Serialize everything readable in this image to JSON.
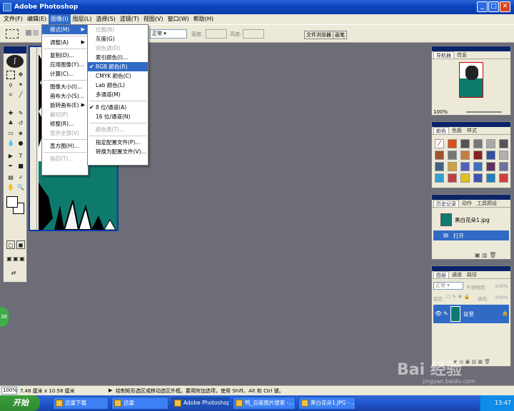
{
  "window": {
    "title": "Adobe Photoshop"
  },
  "menubar": [
    "文件(F)",
    "编辑(E)",
    "图像(I)",
    "图层(L)",
    "选择(S)",
    "滤镜(T)",
    "视图(V)",
    "窗口(W)",
    "帮助(H)"
  ],
  "options": {
    "mode_value": "正常",
    "width_label": "宽度:",
    "height_label": "高度:",
    "file_browser_tab": "文件浏览器",
    "brushes_tab": "画笔"
  },
  "image_menu": [
    {
      "label": "模式(M)",
      "arrow": true,
      "hl": true
    },
    {
      "sep": true
    },
    {
      "label": "调整(A)",
      "arrow": true
    },
    {
      "sep": true
    },
    {
      "label": "复制(D)..."
    },
    {
      "label": "应用图像(Y)..."
    },
    {
      "label": "计算(C)..."
    },
    {
      "sep": true
    },
    {
      "label": "图像大小(I)..."
    },
    {
      "label": "画布大小(S)..."
    },
    {
      "label": "旋转画布(E)",
      "arrow": true
    },
    {
      "label": "裁切(P)",
      "dis": true
    },
    {
      "label": "修整(R)..."
    },
    {
      "label": "显示全部(V)",
      "dis": true
    },
    {
      "sep": true
    },
    {
      "label": "直方图(H)..."
    },
    {
      "sep": true
    },
    {
      "label": "陷印(T)...",
      "dis": true
    }
  ],
  "mode_menu": [
    {
      "label": "位图(B)",
      "dis": true
    },
    {
      "label": "灰度(G)"
    },
    {
      "label": "双色调(D)",
      "dis": true
    },
    {
      "label": "索引颜色(I)..."
    },
    {
      "label": "RGB 颜色(R)",
      "checked": true,
      "hl": true
    },
    {
      "label": "CMYK 颜色(C)"
    },
    {
      "label": "Lab 颜色(L)"
    },
    {
      "label": "多通道(M)"
    },
    {
      "sep": true
    },
    {
      "label": "8 位/通道(A)",
      "checked": true
    },
    {
      "label": "16 位/通道(N)"
    },
    {
      "sep": true
    },
    {
      "label": "颜色表(T)...",
      "dis": true
    },
    {
      "sep": true
    },
    {
      "label": "指定配置文件(P)..."
    },
    {
      "label": "转换为配置文件(V)..."
    }
  ],
  "navigator": {
    "tabs": [
      "导航器",
      "信息"
    ],
    "zoom": "100%"
  },
  "swatches": {
    "tabs": [
      "颜色",
      "色板",
      "样式"
    ]
  },
  "history": {
    "tabs": [
      "历史记录",
      "动作",
      "工具预设"
    ],
    "snapshot": "黑白花朵1.jpg",
    "step": "打开"
  },
  "layers": {
    "tabs": [
      "图层",
      "通道",
      "路径"
    ],
    "blend": "正常",
    "opacity_label": "不透明度:",
    "opacity_value": "100%",
    "lock_label": "锁定:",
    "fill_label": "填充:",
    "fill_value": "100%",
    "layer_name": "背景"
  },
  "status": {
    "zoom": "100%",
    "doc_size": "7.48 厘米 x 10.58 厘米",
    "hint": "绘制矩形选区或移动选区外框。要用附加选项，使用 Shift、Alt 和 Ctrl 键。"
  },
  "taskbar": {
    "start": "开始",
    "tasks": [
      "迅雷下载",
      "迅雷",
      "Adobe Photoshop",
      "鸭_百度图片搜索 -...",
      "黑白花朵1.JPG - ..."
    ],
    "clock": "13:47"
  },
  "watermark": {
    "brand": "Bai 经验",
    "url": "jingyan.baidu.com"
  },
  "colors": {
    "menu_highlight": "#316ac5",
    "teal_image": "#0e7a6e",
    "workspace": "#6d6d77"
  }
}
